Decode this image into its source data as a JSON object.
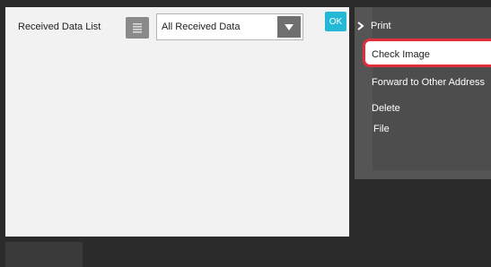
{
  "header": {
    "list_title": "Received Data List",
    "list_icon": "list-icon",
    "filter_value": "All Received Data",
    "filter_arrow_icon": "triangle-down-icon",
    "ok_label": "OK"
  },
  "menu": {
    "chevron_icon": "chevron-right-icon",
    "items": [
      {
        "label": "Print"
      },
      {
        "label": "Check Image"
      },
      {
        "label": "Forward to Other Address"
      },
      {
        "label": "Delete"
      },
      {
        "label": "File"
      }
    ],
    "highlighted_item": "Check Image"
  },
  "colors": {
    "ok_button": "#23b8d6",
    "highlight_border": "#e22d3a",
    "panel_background": "#f2f2f2",
    "menu_background": "#4d4d4d"
  }
}
